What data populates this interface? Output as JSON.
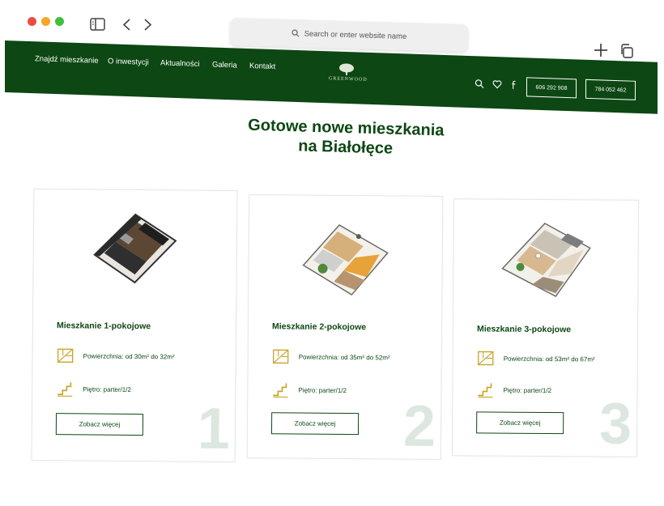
{
  "browser": {
    "address_placeholder": "Search or enter website name"
  },
  "nav": {
    "items": [
      "Znajdź mieszkanie",
      "O inwestycji",
      "Aktualności",
      "Galeria",
      "Kontakt"
    ],
    "logo_text": "GREENWOOD",
    "phone_1": "606 292 908",
    "phone_2": "784 052 462"
  },
  "section_title_line1": "Gotowe nowe mieszkania",
  "section_title_line2": "na Białołęce",
  "cards": [
    {
      "title": "Mieszkanie 1-pokojowe",
      "area_text": "Powierzchnia: od 30m² do 32m²",
      "floor_text": "Piętro: parter/1/2",
      "button": "Zobacz więcej",
      "number": "1"
    },
    {
      "title": "Mieszkanie 2-pokojowe",
      "area_text": "Powierzchnia: od 35m² do 52m²",
      "floor_text": "Piętro: parter/1/2",
      "button": "Zobacz więcej",
      "number": "2"
    },
    {
      "title": "Mieszkanie 3-pokojowe",
      "area_text": "Powierzchnia: od 53m² do 67m²",
      "floor_text": "Piętro: parter/1/2",
      "button": "Zobacz więcej",
      "number": "3"
    }
  ],
  "colors": {
    "brand_green": "#0d4713",
    "accent_gold": "#c9a227",
    "number_tint": "#dce8df"
  }
}
